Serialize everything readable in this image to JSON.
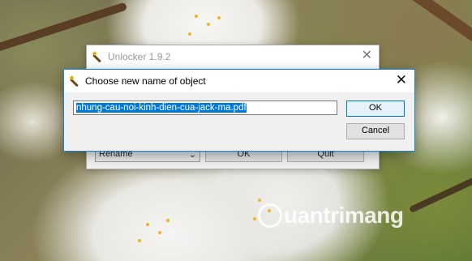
{
  "background_window": {
    "title": "Unlocker 1.9.2",
    "close_glyph": "✕",
    "action_select_value": "Rename",
    "ok_label": "OK",
    "quit_label": "Quit"
  },
  "dialog": {
    "title": "Choose new name of object",
    "close_glyph": "✕",
    "input_value": "nhung-cau-noi-kinh-dien-cua-jack-ma.pdf",
    "ok_label": "OK",
    "cancel_label": "Cancel",
    "accent_color": "#0078d7"
  },
  "watermark": {
    "text": "uantrimang",
    "logo": "quantrimang-q-logo"
  }
}
